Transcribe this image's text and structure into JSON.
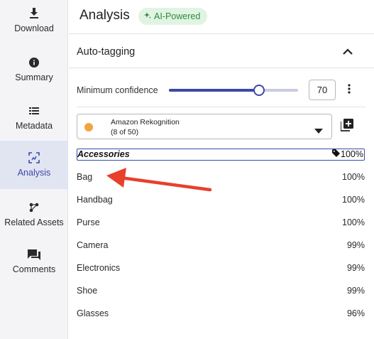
{
  "sidebar": {
    "items": [
      {
        "label": "Download",
        "icon": "download-icon"
      },
      {
        "label": "Summary",
        "icon": "info-icon"
      },
      {
        "label": "Metadata",
        "icon": "list-icon"
      },
      {
        "label": "Analysis",
        "icon": "analysis-icon",
        "active": true
      },
      {
        "label": "Related Assets",
        "icon": "related-assets-icon"
      },
      {
        "label": "Comments",
        "icon": "comments-icon"
      }
    ]
  },
  "header": {
    "title": "Analysis",
    "badge": "AI-Powered"
  },
  "section": {
    "title": "Auto-tagging"
  },
  "confidence": {
    "label": "Minimum confidence",
    "value": "70",
    "slider_fraction": 0.7
  },
  "provider": {
    "name": "Amazon Rekognition",
    "count": "(8 of 50)"
  },
  "tags": [
    {
      "name": "Accessories",
      "confidence": "100%",
      "selected": true
    },
    {
      "name": "Bag",
      "confidence": "100%"
    },
    {
      "name": "Handbag",
      "confidence": "100%"
    },
    {
      "name": "Purse",
      "confidence": "100%"
    },
    {
      "name": "Camera",
      "confidence": "99%"
    },
    {
      "name": "Electronics",
      "confidence": "99%"
    },
    {
      "name": "Shoe",
      "confidence": "99%"
    },
    {
      "name": "Glasses",
      "confidence": "96%"
    }
  ],
  "colors": {
    "accent": "#3c48a8",
    "badge_bg": "#e1f4e3",
    "badge_fg": "#2d8a3e",
    "provider_dot": "#f2a441",
    "annotation_arrow": "#e8402a"
  }
}
